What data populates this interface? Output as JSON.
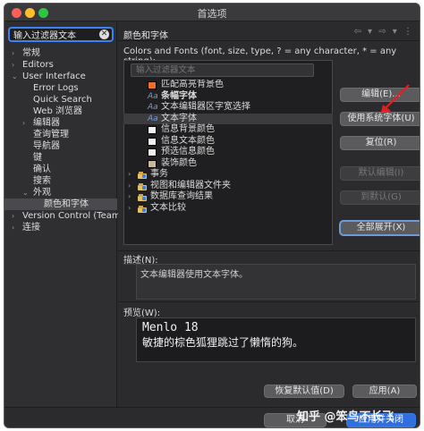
{
  "window": {
    "title": "首选项"
  },
  "filter": {
    "value": "输入过滤器文本"
  },
  "left_tree": [
    {
      "label": "常规",
      "indent": 0,
      "arrow": true
    },
    {
      "label": "Editors",
      "indent": 0,
      "arrow": true
    },
    {
      "label": "User Interface",
      "indent": 0,
      "arrow": true,
      "open": true
    },
    {
      "label": "Error Logs",
      "indent": 1,
      "arrow": false
    },
    {
      "label": "Quick Search",
      "indent": 1,
      "arrow": false
    },
    {
      "label": "Web 浏览器",
      "indent": 1,
      "arrow": false
    },
    {
      "label": "编辑器",
      "indent": 1,
      "arrow": true
    },
    {
      "label": "查询管理",
      "indent": 1,
      "arrow": false
    },
    {
      "label": "导航器",
      "indent": 1,
      "arrow": false
    },
    {
      "label": "键",
      "indent": 1,
      "arrow": false
    },
    {
      "label": "确认",
      "indent": 1,
      "arrow": false
    },
    {
      "label": "搜索",
      "indent": 1,
      "arrow": false
    },
    {
      "label": "外观",
      "indent": 1,
      "arrow": true,
      "open": true
    },
    {
      "label": "颜色和字体",
      "indent": 2,
      "arrow": false,
      "selected": true
    },
    {
      "label": "Version Control (Team)",
      "indent": 0,
      "arrow": true
    },
    {
      "label": "连接",
      "indent": 0,
      "arrow": true
    }
  ],
  "pane": {
    "title": "颜色和字体",
    "nav_icons": "⇦ ▾ ⇨ ▾ ⋮",
    "colors_fonts_label": "Colors and Fonts (font, size, type, ? = any character, * = any string):",
    "list_filter_placeholder": "输入过滤器文本"
  },
  "list_items": [
    {
      "kind": "swatch",
      "color": "#e8702a",
      "label": "匹配高亮背景色"
    },
    {
      "kind": "font",
      "label": "条幅字体",
      "bold": true
    },
    {
      "kind": "font",
      "label": "文本编辑器区字宽选择"
    },
    {
      "kind": "font",
      "label": "文本字体",
      "selected": true
    },
    {
      "kind": "swatch",
      "color": "#f2f2f2",
      "label": "信息背景颜色"
    },
    {
      "kind": "swatch",
      "color": "#f2f2f2",
      "label": "信息文本颜色"
    },
    {
      "kind": "swatch",
      "color": "#f0f0f0",
      "label": "预选信息颜色"
    },
    {
      "kind": "swatch",
      "color": "#c8b8a0",
      "label": "装饰颜色"
    },
    {
      "kind": "category",
      "label": "事务"
    },
    {
      "kind": "category",
      "label": "视图和编辑器文件夹"
    },
    {
      "kind": "category",
      "label": "数据库查询结果"
    },
    {
      "kind": "category",
      "label": "文本比较"
    }
  ],
  "buttons": {
    "edit": "编辑(E)...",
    "use_system_font": "使用系统字体(U)",
    "reset": "复位(R)",
    "edit_default": "默认编辑(I)",
    "goto_default": "到默认(G)",
    "expand_all": "全部展开(X)"
  },
  "description": {
    "label": "描述(N):",
    "text": "文本编辑器使用文本字体。"
  },
  "preview": {
    "label": "预览(W):",
    "line1": "Menlo 18",
    "line2": "敏捷的棕色狐狸跳过了懒惰的狗。"
  },
  "bottom": {
    "restore_defaults": "恢复默认值(D)",
    "apply": "应用(A)"
  },
  "footer": {
    "cancel": "取消",
    "apply_close": "应用并关闭"
  },
  "watermark": "知乎 @笨鸟不长飞"
}
